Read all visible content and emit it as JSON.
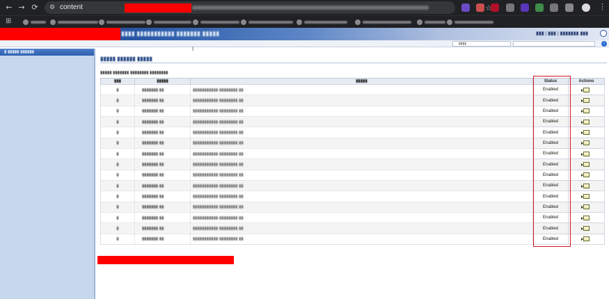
{
  "browser": {
    "url_prefix": "content",
    "nav": {
      "back_icon": "←",
      "forward_icon": "→",
      "reload_icon": "⟳"
    },
    "star_icon": "☆",
    "apps_icon": "⊞",
    "menu_icon": "⋮",
    "extension_colors": [
      "#6a4bc6",
      "#c94f4f",
      "#b0102a",
      "#777777",
      "#5a36b8",
      "#3f8b4a",
      "#777777",
      "#888888"
    ],
    "bookmark_count_visible": 9
  },
  "main": {
    "table": {
      "columns": {
        "key": "",
        "label": "",
        "query": "",
        "status": "Status",
        "actions": "Actions"
      },
      "rows": [
        {
          "status": "Enabled"
        },
        {
          "status": "Enabled"
        },
        {
          "status": "Enabled"
        },
        {
          "status": "Enabled"
        },
        {
          "status": "Enabled"
        },
        {
          "status": "Enabled"
        },
        {
          "status": "Enabled"
        },
        {
          "status": "Enabled"
        },
        {
          "status": "Enabled"
        },
        {
          "status": "Enabled"
        },
        {
          "status": "Enabled"
        },
        {
          "status": "Enabled"
        },
        {
          "status": "Enabled"
        },
        {
          "status": "Enabled"
        },
        {
          "status": "Enabled"
        }
      ],
      "action_icon": "edit-icon"
    },
    "highlight_color": "#d9141f",
    "redaction_color": "#ff0000"
  }
}
